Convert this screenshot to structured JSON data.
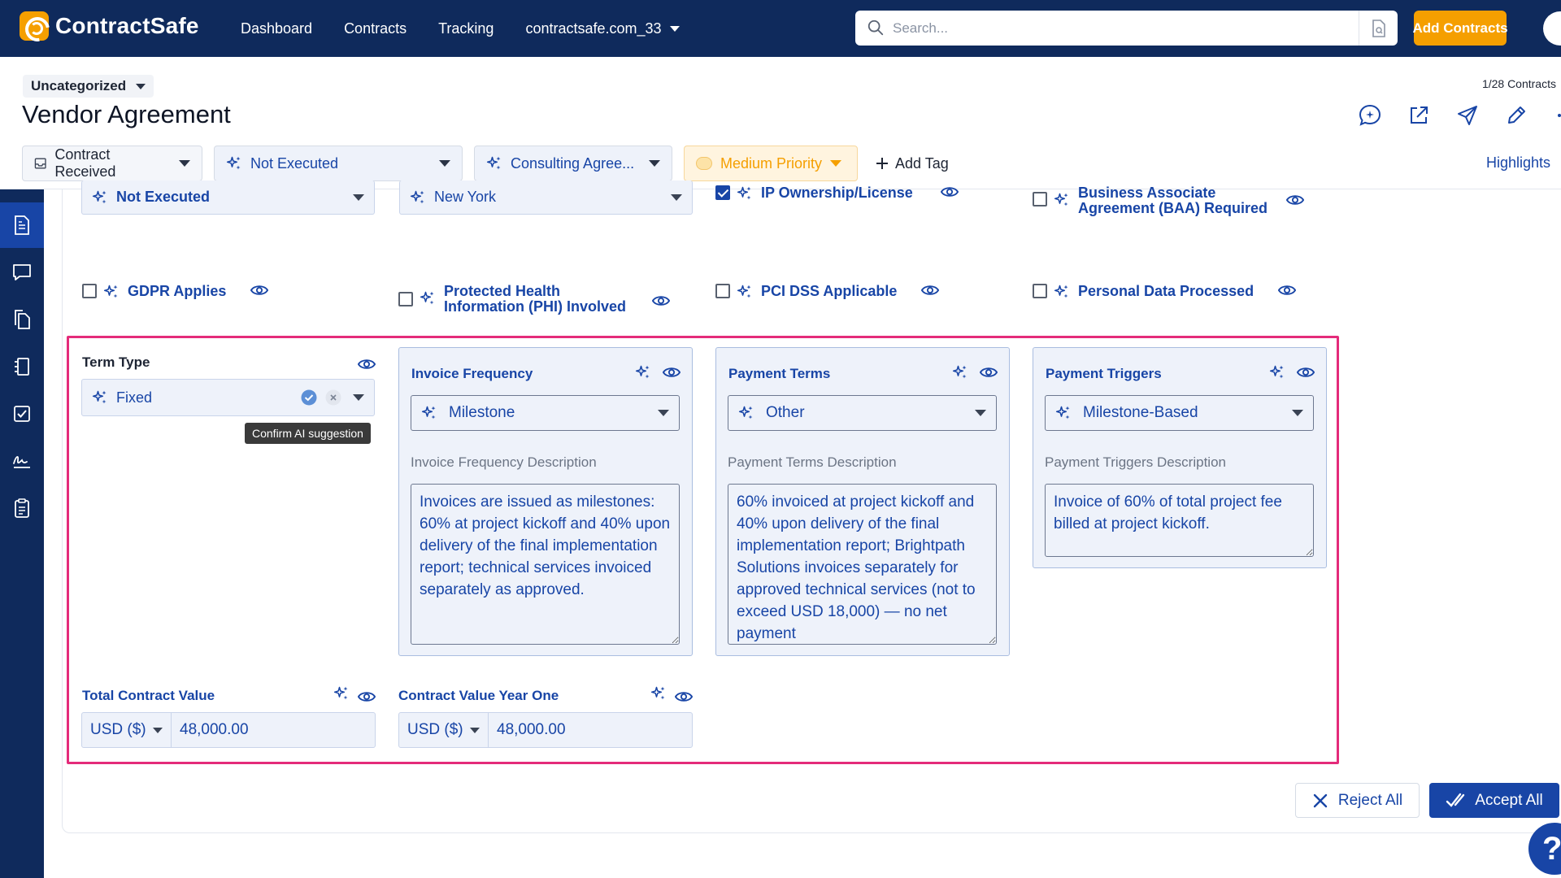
{
  "app": {
    "name": "ContractSafe"
  },
  "nav": {
    "dashboard": "Dashboard",
    "contracts": "Contracts",
    "tracking": "Tracking",
    "account": "contractsafe.com_33"
  },
  "search": {
    "placeholder": "Search..."
  },
  "add_contracts": "Add Contracts",
  "header": {
    "category": "Uncategorized",
    "title": "Vendor Agreement",
    "counter": "1/28 Contracts",
    "highlights": "Highlights"
  },
  "status": {
    "stage": "Contract Received",
    "execution": "Not Executed",
    "type": "Consulting Agree...",
    "priority": "Medium Priority",
    "add_tag": "Add Tag"
  },
  "top_fields": {
    "execution_value": "Not Executed",
    "location_value": "New York",
    "ip_label": "IP Ownership/License",
    "baa_label": "Business Associate Agreement (BAA) Required"
  },
  "flags": {
    "gdpr": "GDPR Applies",
    "phi": "Protected Health Information (PHI) Involved",
    "pci": "PCI DSS Applicable",
    "personal": "Personal Data Processed"
  },
  "term_type": {
    "label": "Term Type",
    "value": "Fixed",
    "tooltip": "Confirm AI suggestion"
  },
  "panels": [
    {
      "title": "Invoice Frequency",
      "value": "Milestone",
      "desc_label": "Invoice Frequency Description",
      "desc": "Invoices are issued as milestones: 60% at project kickoff and 40% upon delivery of the final implementation report; technical services invoiced separately as approved."
    },
    {
      "title": "Payment Terms",
      "value": "Other",
      "desc_label": "Payment Terms Description",
      "desc": "60% invoiced at project kickoff and 40% upon delivery of the final implementation report; Brightpath Solutions invoices separately for approved technical services (not to exceed USD 18,000) — no net payment"
    },
    {
      "title": "Payment Triggers",
      "value": "Milestone-Based",
      "desc_label": "Payment Triggers Description",
      "desc": "Invoice of 60% of total project fee billed at project kickoff."
    }
  ],
  "money": {
    "total_label": "Total Contract Value",
    "total_currency": "USD ($)",
    "total_value": "48,000.00",
    "year_one_label": "Contract Value Year One",
    "year_one_currency": "USD ($)",
    "year_one_value": "48,000.00"
  },
  "actions": {
    "reject": "Reject All",
    "accept": "Accept All"
  },
  "help": "?",
  "colors": {
    "navy": "#0f2a5c",
    "brand_blue": "#1845a6",
    "orange": "#f59f00",
    "highlight_pink": "#e42b7a"
  }
}
